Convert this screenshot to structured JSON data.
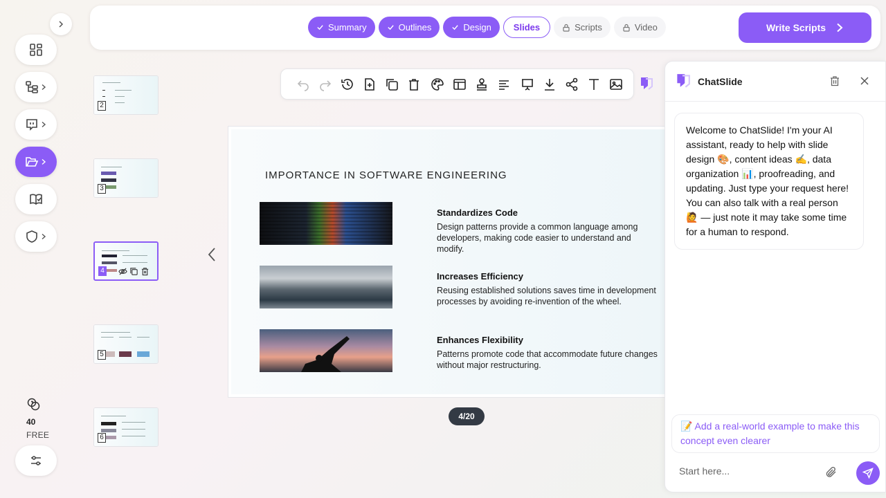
{
  "rail": {
    "credits_value": "40",
    "plan": "FREE"
  },
  "steps": [
    {
      "label": "Summary",
      "state": "done"
    },
    {
      "label": "Outlines",
      "state": "done"
    },
    {
      "label": "Design",
      "state": "done"
    },
    {
      "label": "Slides",
      "state": "current"
    },
    {
      "label": "Scripts",
      "state": "locked"
    },
    {
      "label": "Video",
      "state": "locked"
    }
  ],
  "write_scripts_label": "Write Scripts",
  "thumbnails": [
    {
      "number": "2",
      "active": false
    },
    {
      "number": "3",
      "active": false
    },
    {
      "number": "4",
      "active": true
    },
    {
      "number": "5",
      "active": false
    },
    {
      "number": "6",
      "active": false
    }
  ],
  "toolbar_icons": [
    "undo-icon",
    "redo-icon",
    "history-icon",
    "add-page-icon",
    "duplicate-icon",
    "delete-icon",
    "palette-icon",
    "layout-icon",
    "stamp-icon",
    "align-icon",
    "present-icon",
    "download-icon",
    "share-icon",
    "text-icon",
    "image-icon"
  ],
  "slide": {
    "title": "IMPORTANCE IN SOFTWARE ENGINEERING",
    "items": [
      {
        "heading": "Standardizes Code",
        "text": "Design patterns provide a common language among developers, making code easier to understand and modify."
      },
      {
        "heading": "Increases Efficiency",
        "text": "Reusing established solutions saves time in development processes by avoiding re-invention of the wheel."
      },
      {
        "heading": "Enhances Flexibility",
        "text": "Patterns promote code that accommodate future changes without major restructuring."
      }
    ],
    "page_indicator": "4/20"
  },
  "chat": {
    "title": "ChatSlide",
    "welcome": "Welcome to ChatSlide! I'm your AI assistant, ready to help with slide design 🎨, content ideas ✍️, data organization 📊, proofreading, and updating. Just type your request here! You can also talk with a real person 🙋 — just note it may take some time for a human to respond.",
    "suggestion": "📝 Add a real-world example to make this concept even clearer",
    "input_placeholder": "Start here..."
  },
  "colors": {
    "accent": "#8b5cf6",
    "page_pill": "#333a44"
  }
}
